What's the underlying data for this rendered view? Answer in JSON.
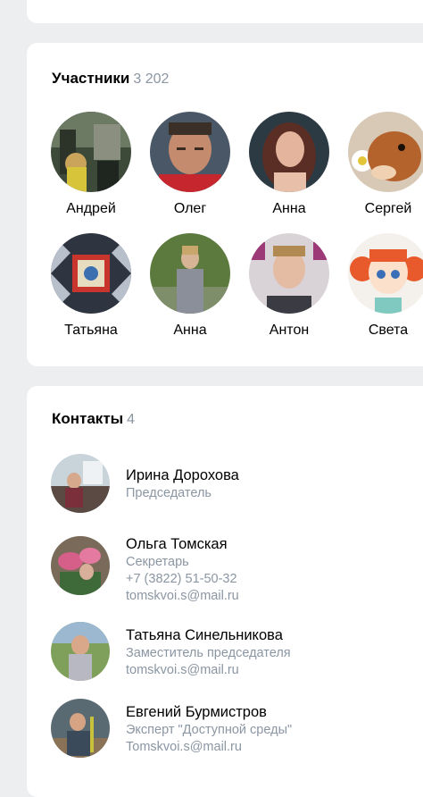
{
  "members": {
    "title": "Участники",
    "count": "3 202",
    "items": [
      {
        "name": "Андрей",
        "icon": "photo-workers"
      },
      {
        "name": "Олег",
        "icon": "photo-man"
      },
      {
        "name": "Анна",
        "icon": "photo-woman"
      },
      {
        "name": "Сергей",
        "icon": "photo-squirrel"
      },
      {
        "name": "Татьяна",
        "icon": "photo-quilt"
      },
      {
        "name": "Анна",
        "icon": "photo-woman-outdoor"
      },
      {
        "name": "Антон",
        "icon": "photo-young-man"
      },
      {
        "name": "Света",
        "icon": "photo-cartoon-girl"
      }
    ]
  },
  "contacts": {
    "title": "Контакты",
    "count": "4",
    "items": [
      {
        "name": "Ирина Дорохова",
        "role": "Председатель",
        "phone": "",
        "email": ""
      },
      {
        "name": "Ольга Томская",
        "role": "Секретарь",
        "phone": "+7 (3822) 51-50-32",
        "email": "tomskvoi.s@mail.ru"
      },
      {
        "name": "Татьяна Синельникова",
        "role": "Заместитель председателя",
        "phone": "",
        "email": "tomskvoi.s@mail.ru"
      },
      {
        "name": "Евгений Бурмистров",
        "role": "Эксперт \"Доступной среды\"",
        "phone": "",
        "email": "Tomskvoi.s@mail.ru"
      }
    ]
  }
}
